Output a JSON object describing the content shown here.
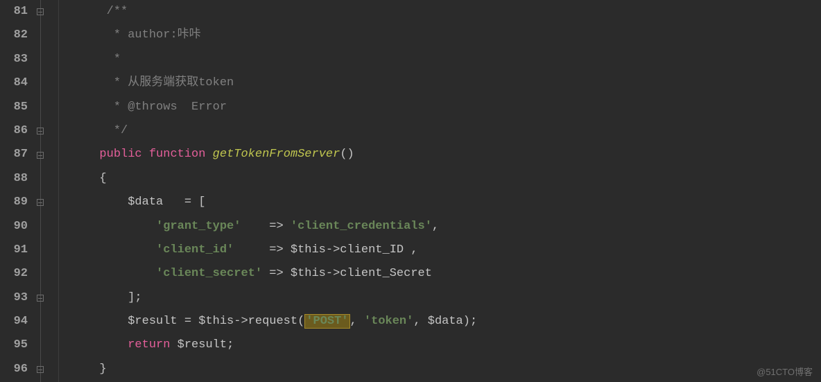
{
  "line_numbers": [
    "81",
    "82",
    "83",
    "84",
    "85",
    "86",
    "87",
    "88",
    "89",
    "90",
    "91",
    "92",
    "93",
    "94",
    "95",
    "96"
  ],
  "code": {
    "l81": {
      "comment_open": "/**"
    },
    "l82": {
      "star": " * ",
      "txt": "author:咔咔"
    },
    "l83": {
      "star": " *"
    },
    "l84": {
      "star": " * ",
      "txt": "从服务端获取token"
    },
    "l85": {
      "star": " * ",
      "tag": "@throws",
      "rest": "  Error"
    },
    "l86": {
      "star": " */"
    },
    "l87": {
      "kw_public": "public",
      "kw_function": "function",
      "method": "getTokenFromServer",
      "parens": "()"
    },
    "l88": {
      "brace": "{"
    },
    "l89": {
      "var": "$data",
      "assign": "   = [",
      "open_bracket": "["
    },
    "l90": {
      "key": "'grant_type'",
      "arrow": "    => ",
      "val": "'client_credentials'",
      "comma": ","
    },
    "l91": {
      "key": "'client_id'",
      "arrow": "     => ",
      "this": "$this",
      "member_op": "->",
      "member": "client_ID",
      "tail": " ,"
    },
    "l92": {
      "key": "'client_secret'",
      "arrow": " => ",
      "this": "$this",
      "member_op": "->",
      "member": "client_Secret"
    },
    "l93": {
      "close": "];"
    },
    "l94": {
      "var": "$result",
      "eq": " = ",
      "this": "$this",
      "member_op": "->",
      "call": "request",
      "open": "(",
      "arg1": "'POST'",
      "c1": ", ",
      "arg2": "'token'",
      "c2": ", ",
      "arg3": "$data",
      "close": ");"
    },
    "l95": {
      "ret": "return",
      "sp": " ",
      "var": "$result",
      "semi": ";"
    },
    "l96": {
      "brace": "}"
    }
  },
  "watermark": "@51CTO博客"
}
